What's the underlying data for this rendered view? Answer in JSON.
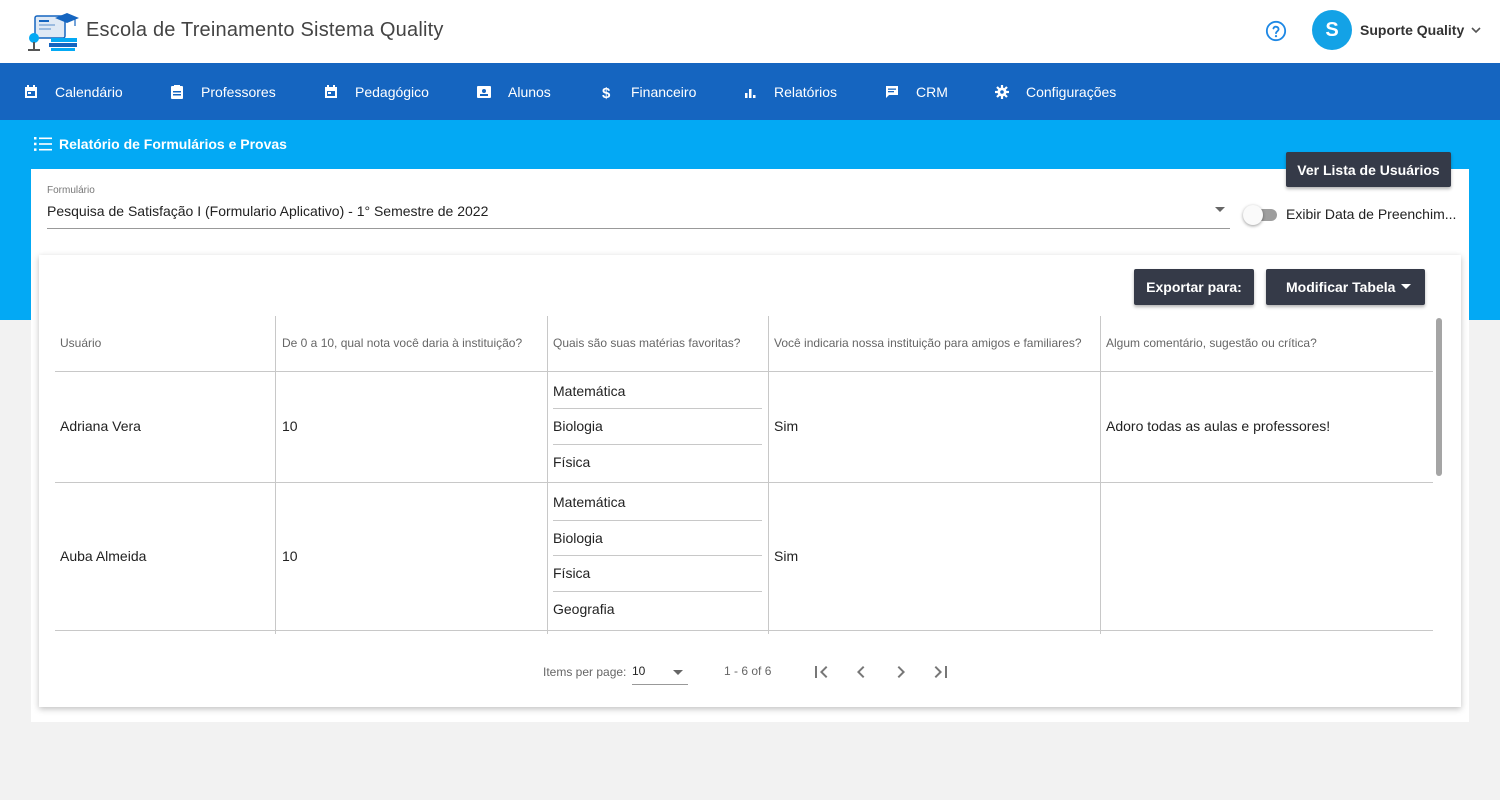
{
  "header": {
    "title": "Escola de Treinamento Sistema Quality",
    "help_icon": "help-circle-icon",
    "user": {
      "initial": "S",
      "name": "Suporte Quality"
    }
  },
  "nav": {
    "items": [
      {
        "label": "Calendário",
        "icon": "calendar-icon"
      },
      {
        "label": "Professores",
        "icon": "clipboard-icon"
      },
      {
        "label": "Pedagógico",
        "icon": "calendar-icon"
      },
      {
        "label": "Alunos",
        "icon": "contact-card-icon"
      },
      {
        "label": "Financeiro",
        "icon": "dollar-icon"
      },
      {
        "label": "Relatórios",
        "icon": "bar-chart-icon"
      },
      {
        "label": "CRM",
        "icon": "message-icon"
      },
      {
        "label": "Configurações",
        "icon": "gear-icon"
      }
    ]
  },
  "page": {
    "title": "Relatório de Formulários e Provas",
    "user_list_button": "Ver Lista de Usuários",
    "form_field": {
      "label": "Formulário",
      "value": "Pesquisa de Satisfação I (Formulario Aplicativo) - 1° Semestre de 2022"
    },
    "toggle": {
      "label": "Exibir Data de Preenchim...",
      "checked": false
    }
  },
  "toolbar": {
    "export_label": "Exportar para:",
    "modify_label": "Modificar Tabela"
  },
  "table": {
    "headers": [
      "Usuário",
      "De 0 a 10, qual nota você daria à instituição?",
      "Quais são suas matérias favoritas?",
      "Você indicaria nossa instituição para amigos e familiares?",
      "Algum comentário, sugestão ou crítica?"
    ],
    "rows": [
      {
        "user": "Adriana Vera",
        "score": "10",
        "subjects": [
          "Matemática",
          "Biologia",
          "Física"
        ],
        "recommend": "Sim",
        "comment": "Adoro todas as aulas e professores!"
      },
      {
        "user": "Auba Almeida",
        "score": "10",
        "subjects": [
          "Matemática",
          "Biologia",
          "Física",
          "Geografia"
        ],
        "recommend": "Sim",
        "comment": ""
      }
    ]
  },
  "paginator": {
    "items_per_page_label": "Items per page:",
    "page_size": "10",
    "range": "1 - 6 of 6"
  },
  "colors": {
    "nav_bg": "#1565c0",
    "band_bg": "#03a9f4",
    "avatar_bg": "#13a2e6",
    "dark_button": "#353a48"
  }
}
